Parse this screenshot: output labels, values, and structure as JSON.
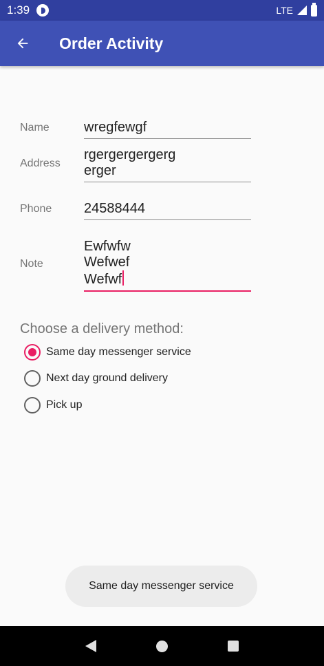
{
  "status_bar": {
    "time": "1:39",
    "network": "LTE",
    "icons": [
      "app-notification-icon",
      "signal-icon",
      "battery-icon"
    ]
  },
  "app_bar": {
    "title": "Order Activity",
    "back_icon": "arrow-back-icon"
  },
  "form": {
    "name_label": "Name",
    "name_value": "wregfewgf",
    "address_label": "Address",
    "address_value": "rgergergergerg\nerger",
    "phone_label": "Phone",
    "phone_value": "24588444",
    "note_label": "Note",
    "note_value": "Ewfwfw\nWefwef\nWefwf"
  },
  "delivery": {
    "title": "Choose a delivery method:",
    "options": [
      {
        "label": "Same day messenger service",
        "checked": true
      },
      {
        "label": "Next day ground delivery",
        "checked": false
      },
      {
        "label": "Pick up",
        "checked": false
      }
    ]
  },
  "toast": {
    "message": "Same day messenger service"
  },
  "colors": {
    "primary": "#3f51b5",
    "primary_dark": "#303f9f",
    "accent": "#e91e63"
  },
  "nav_bar": {
    "icons": [
      "nav-back-icon",
      "nav-home-icon",
      "nav-recents-icon"
    ]
  }
}
